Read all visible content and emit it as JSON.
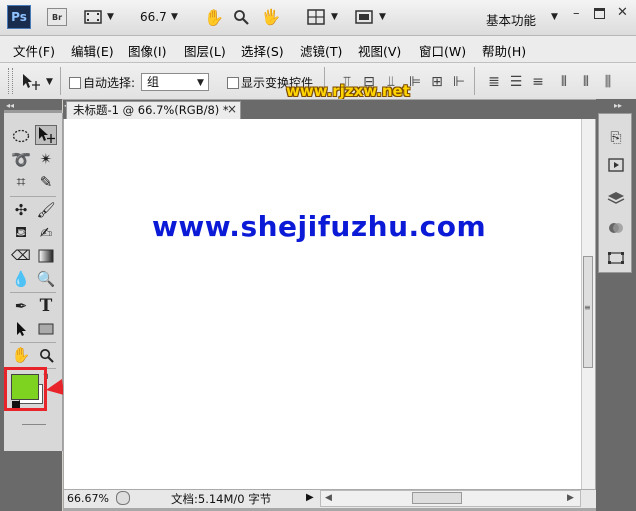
{
  "appbar": {
    "ps_logo": "Ps",
    "br_logo": "Br",
    "zoom": "66.7",
    "workspace": "基本功能"
  },
  "menus": [
    {
      "label": "文件(F)"
    },
    {
      "label": "编辑(E)"
    },
    {
      "label": "图像(I)"
    },
    {
      "label": "图层(L)"
    },
    {
      "label": "选择(S)"
    },
    {
      "label": "滤镜(T)"
    },
    {
      "label": "视图(V)"
    },
    {
      "label": "窗口(W)"
    },
    {
      "label": "帮助(H)"
    }
  ],
  "options": {
    "auto_select_label": "自动选择:",
    "auto_select_value": "组",
    "show_transform_label": "显示变换控件"
  },
  "watermark": "www.rjzxw.net",
  "document": {
    "tab_title": "未标题-1 @ 66.7%(RGB/8) *",
    "tab_close": "×",
    "canvas_text": "www.shejifuzhu.com"
  },
  "status": {
    "zoom": "66.67%",
    "doc_info": "文档:5.14M/0 字节"
  },
  "colors": {
    "foreground": "#7ed321",
    "background": "#ffffff",
    "canvas_text": "#0a1ad6",
    "highlight": "#e8242a"
  }
}
